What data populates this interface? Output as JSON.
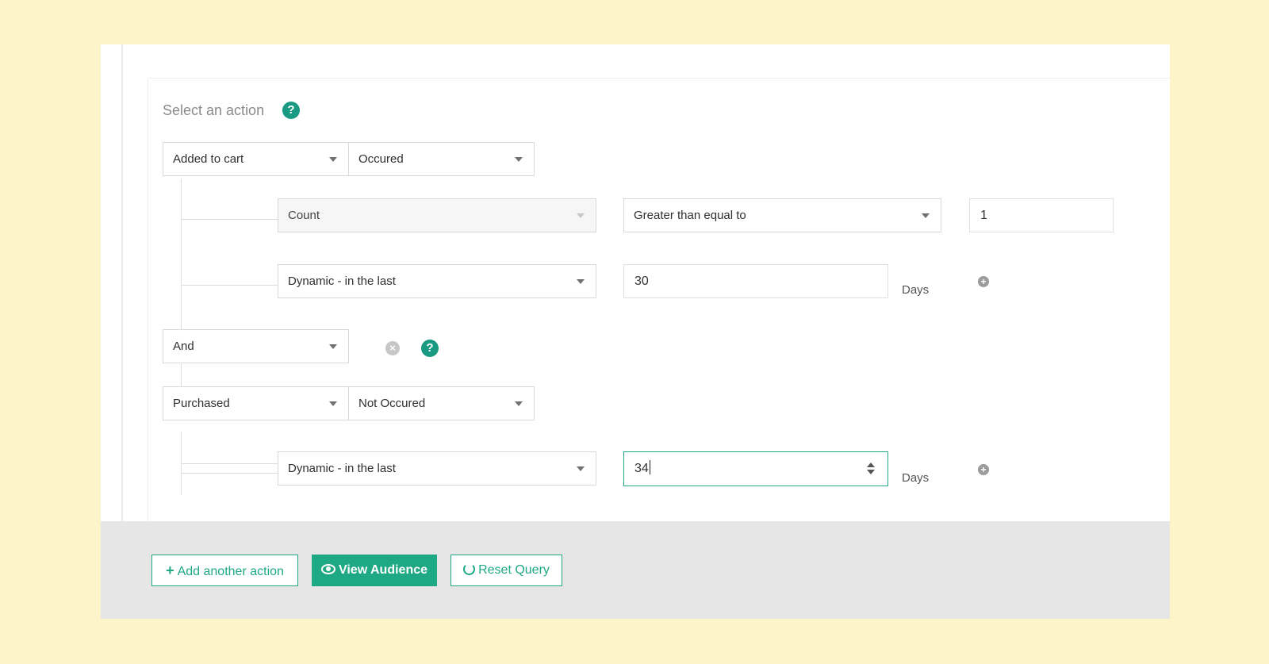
{
  "section": {
    "title": "Select an action",
    "help_glyph": "?"
  },
  "action1": {
    "event": "Added to cart",
    "occurrence": "Occured",
    "metric": "Count",
    "operator": "Greater than equal to",
    "operator_value": "1",
    "time_mode": "Dynamic - in the last",
    "time_value": "30",
    "time_unit": "Days"
  },
  "connector": {
    "value": "And",
    "remove_glyph": "×",
    "help_glyph": "?"
  },
  "action2": {
    "event": "Purchased",
    "occurrence": "Not Occured",
    "time_mode": "Dynamic - in the last",
    "time_value": "34",
    "time_unit": "Days"
  },
  "add_glyph": "+",
  "footer": {
    "add_action_label": "Add another action",
    "add_action_icon": "+",
    "view_audience_label": "View Audience",
    "reset_query_label": "Reset Query"
  },
  "colors": {
    "accent": "#1fa884",
    "help": "#1a9a82",
    "background": "#fdf5c9",
    "footer": "#e6e6e6"
  }
}
